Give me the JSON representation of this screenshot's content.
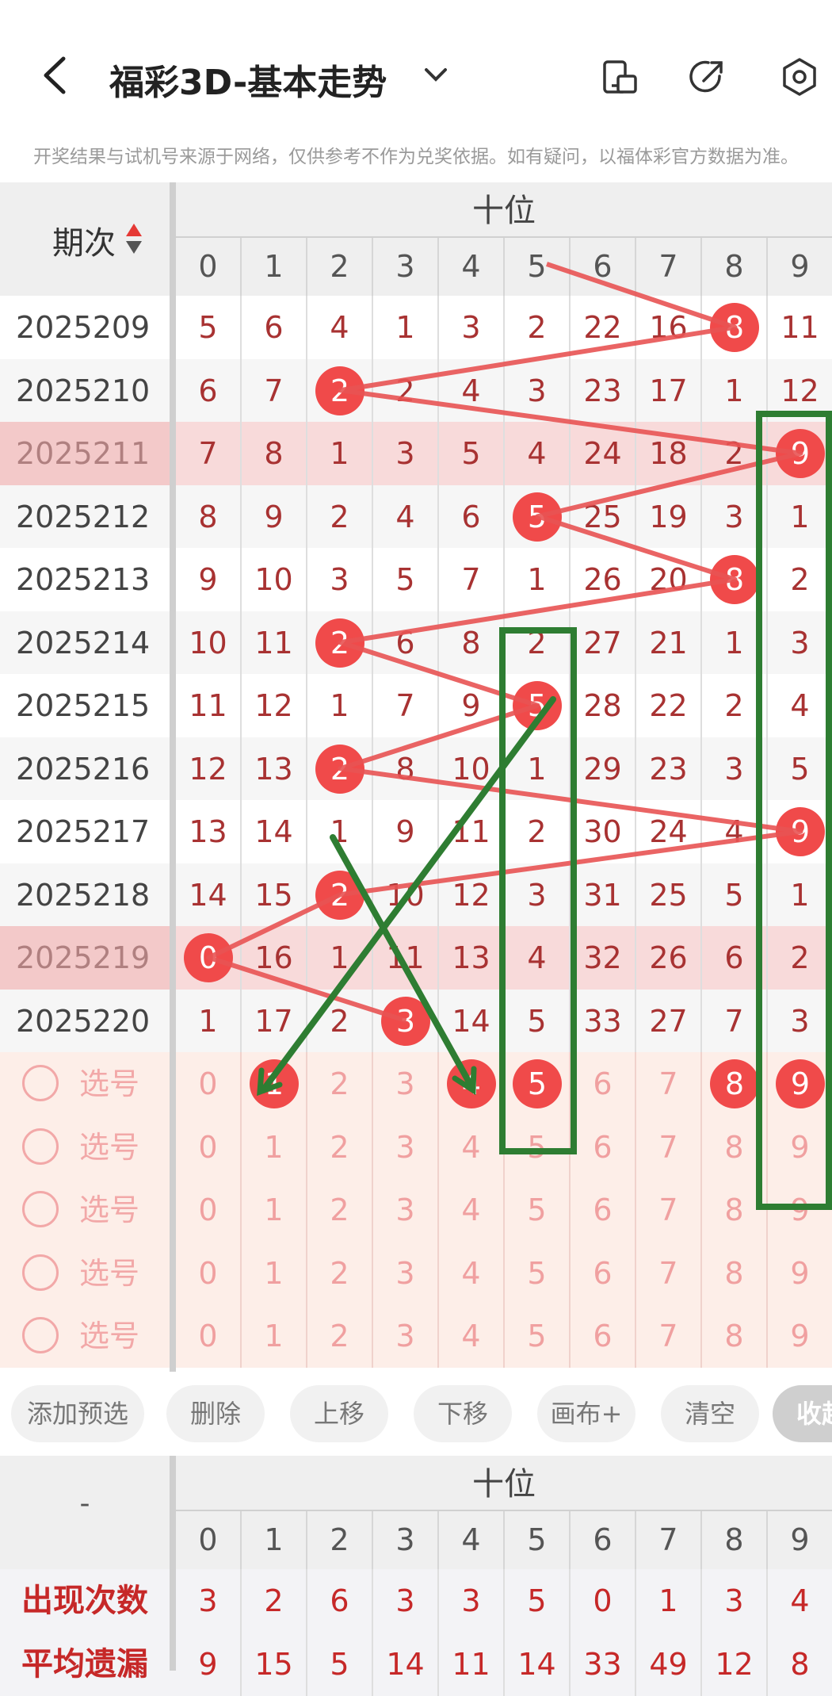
{
  "header": {
    "title": "福彩3D-基本走势"
  },
  "notice": "开奖结果与试机号来源于网络，仅供参考不作为兑奖依据。如有疑问，以福体彩官方数据为准。",
  "table": {
    "period_header": "期次",
    "group_label": "十位",
    "digits": [
      "0",
      "1",
      "2",
      "3",
      "4",
      "5",
      "6",
      "7",
      "8",
      "9"
    ],
    "rows": [
      {
        "period": "2025209",
        "cells": [
          "5",
          "6",
          "4",
          "1",
          "3",
          "2",
          "22",
          "16",
          "8",
          "11"
        ],
        "hit": 8,
        "highlight": false
      },
      {
        "period": "2025210",
        "cells": [
          "6",
          "7",
          "2",
          "2",
          "4",
          "3",
          "23",
          "17",
          "1",
          "12"
        ],
        "hit": 2,
        "highlight": false
      },
      {
        "period": "2025211",
        "cells": [
          "7",
          "8",
          "1",
          "3",
          "5",
          "4",
          "24",
          "18",
          "2",
          "9"
        ],
        "hit": 9,
        "highlight": true
      },
      {
        "period": "2025212",
        "cells": [
          "8",
          "9",
          "2",
          "4",
          "6",
          "5",
          "25",
          "19",
          "3",
          "1"
        ],
        "hit": 5,
        "highlight": false
      },
      {
        "period": "2025213",
        "cells": [
          "9",
          "10",
          "3",
          "5",
          "7",
          "1",
          "26",
          "20",
          "8",
          "2"
        ],
        "hit": 8,
        "highlight": false
      },
      {
        "period": "2025214",
        "cells": [
          "10",
          "11",
          "2",
          "6",
          "8",
          "2",
          "27",
          "21",
          "1",
          "3"
        ],
        "hit": 2,
        "highlight": false
      },
      {
        "period": "2025215",
        "cells": [
          "11",
          "12",
          "1",
          "7",
          "9",
          "5",
          "28",
          "22",
          "2",
          "4"
        ],
        "hit": 5,
        "highlight": false
      },
      {
        "period": "2025216",
        "cells": [
          "12",
          "13",
          "2",
          "8",
          "10",
          "1",
          "29",
          "23",
          "3",
          "5"
        ],
        "hit": 2,
        "highlight": false
      },
      {
        "period": "2025217",
        "cells": [
          "13",
          "14",
          "1",
          "9",
          "11",
          "2",
          "30",
          "24",
          "4",
          "9"
        ],
        "hit": 9,
        "highlight": false
      },
      {
        "period": "2025218",
        "cells": [
          "14",
          "15",
          "2",
          "10",
          "12",
          "3",
          "31",
          "25",
          "5",
          "1"
        ],
        "hit": 2,
        "highlight": false
      },
      {
        "period": "2025219",
        "cells": [
          "0",
          "16",
          "1",
          "11",
          "13",
          "4",
          "32",
          "26",
          "6",
          "2"
        ],
        "hit": 0,
        "highlight": true
      },
      {
        "period": "2025220",
        "cells": [
          "1",
          "17",
          "2",
          "3",
          "14",
          "5",
          "33",
          "27",
          "7",
          "3"
        ],
        "hit": 3,
        "highlight": false
      }
    ],
    "preselect_label": "选号",
    "preselect_rows": [
      {
        "picked": [
          1,
          4,
          5,
          8,
          9
        ]
      },
      {
        "picked": []
      },
      {
        "picked": []
      },
      {
        "picked": []
      },
      {
        "picked": []
      }
    ]
  },
  "toolbar": {
    "buttons": [
      "添加预选",
      "删除",
      "上移",
      "下移",
      "画布+",
      "清空",
      "收起"
    ]
  },
  "stats": {
    "corner": "-",
    "group_label": "十位",
    "rows": [
      {
        "label": "出现次数",
        "cells": [
          "3",
          "2",
          "6",
          "3",
          "3",
          "5",
          "0",
          "1",
          "3",
          "4"
        ]
      },
      {
        "label": "平均遗漏",
        "cells": [
          "9",
          "15",
          "5",
          "14",
          "11",
          "14",
          "33",
          "49",
          "12",
          "8"
        ]
      }
    ]
  },
  "colors": {
    "ball": "#f04a4a",
    "trend_line": "#e85353",
    "annotation": "#2e7d32",
    "highlight_row": "#f8dada",
    "preselect_bg": "#fdeee8"
  }
}
